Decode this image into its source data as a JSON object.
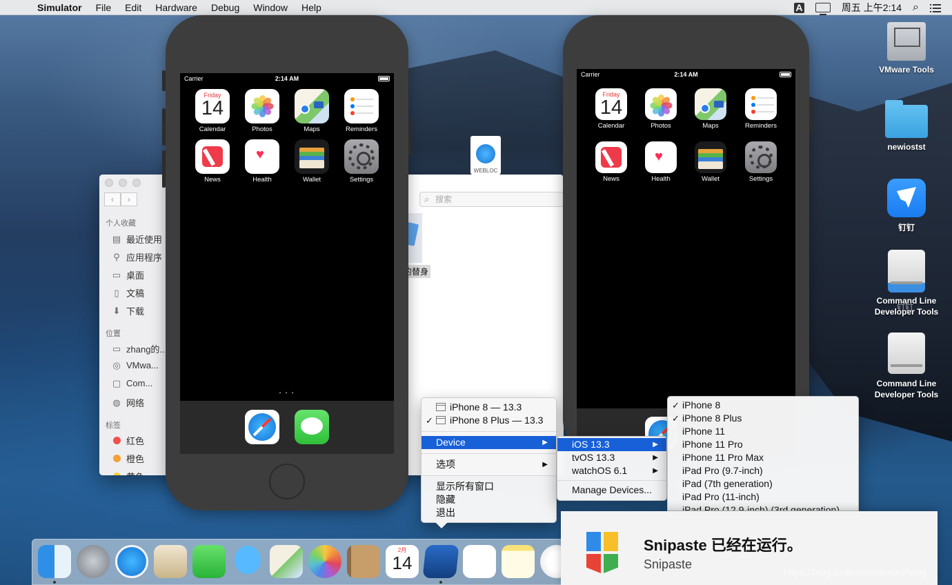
{
  "menubar": {
    "app_name": "Simulator",
    "items": [
      "File",
      "Edit",
      "Hardware",
      "Debug",
      "Window",
      "Help"
    ],
    "input_badge": "A",
    "clock": "周五 上午2:14"
  },
  "finder": {
    "search_placeholder": "搜索",
    "sections": {
      "favorites": "个人收藏",
      "locations": "位置",
      "tags": "标签"
    },
    "favorites": [
      "最近使用",
      "应用程序",
      "桌面",
      "文稿",
      "下载"
    ],
    "locations": [
      "zhang的...",
      "VMwa...",
      "Com...",
      "网络"
    ],
    "tags": [
      {
        "label": "红色",
        "color": "#f2504b"
      },
      {
        "label": "橙色",
        "color": "#f6a033"
      },
      {
        "label": "黄色",
        "color": "#f5cf3a"
      }
    ],
    "file_label": "的替身"
  },
  "webloc": {
    "label": "WEBLOC"
  },
  "device_left": {
    "carrier": "Carrier",
    "time": "2:14 AM",
    "page_dots": "• • •",
    "apps": [
      {
        "name": "Calendar",
        "icon": "calendar-icon"
      },
      {
        "name": "Photos",
        "icon": "photos-icon"
      },
      {
        "name": "Maps",
        "icon": "maps-icon"
      },
      {
        "name": "Reminders",
        "icon": "reminders-icon"
      },
      {
        "name": "News",
        "icon": "news-icon"
      },
      {
        "name": "Health",
        "icon": "health-icon"
      },
      {
        "name": "Wallet",
        "icon": "wallet-icon"
      },
      {
        "name": "Settings",
        "icon": "settings-icon"
      }
    ],
    "calendar_day": "Friday",
    "calendar_date": "14"
  },
  "device_right": {
    "carrier": "Carrier",
    "time": "2:14 AM",
    "apps": [
      "Calendar",
      "Photos",
      "Maps",
      "Reminders",
      "News",
      "Health",
      "Wallet",
      "Settings"
    ],
    "calendar_day": "Friday",
    "calendar_date": "14"
  },
  "desktop_icons": [
    {
      "label": "VMware Tools",
      "icon": "vmware-tools-icon"
    },
    {
      "label": "newiostst",
      "icon": "folder-icon"
    },
    {
      "label": "钉钉",
      "icon": "dingtalk-icon"
    },
    {
      "label": "Command Line Developer Tools",
      "icon": "drive-icon"
    },
    {
      "label": "Command Line Developer Tools",
      "icon": "drive-icon"
    }
  ],
  "overlap_label": "钉钉",
  "context_menu": {
    "windows": [
      {
        "label": "iPhone 8 — 13.3",
        "checked": false
      },
      {
        "label": "iPhone 8 Plus — 13.3",
        "checked": true
      }
    ],
    "device": "Device",
    "options": "选项",
    "show_all": "显示所有窗口",
    "hide": "隐藏",
    "quit": "退出"
  },
  "os_menu": {
    "items": [
      "iOS 13.3",
      "tvOS 13.3",
      "watchOS 6.1"
    ],
    "manage": "Manage Devices..."
  },
  "device_menu": {
    "items": [
      {
        "label": "iPhone 8",
        "checked": true
      },
      {
        "label": "iPhone 8 Plus",
        "checked": true
      },
      {
        "label": "iPhone 11",
        "checked": false
      },
      {
        "label": "iPhone 11 Pro",
        "checked": false
      },
      {
        "label": "iPhone 11 Pro Max",
        "checked": false
      },
      {
        "label": "iPad Pro (9.7-inch)",
        "checked": false
      },
      {
        "label": "iPad (7th generation)",
        "checked": false
      },
      {
        "label": "iPad Pro (11-inch)",
        "checked": false
      },
      {
        "label": "iPad Pro (12.9-inch) (3rd generation)",
        "checked": false
      }
    ]
  },
  "dock": {
    "apps": [
      "finder-icon",
      "launchpad-icon",
      "safari-icon",
      "mail-icon",
      "facetime-icon",
      "messages-icon",
      "maps-icon",
      "photos-icon",
      "contacts-icon",
      "calendar-icon",
      "xcode-icon",
      "reminders-icon",
      "notes-icon",
      "itunes-icon"
    ],
    "calendar_month": "2月",
    "calendar_date": "14"
  },
  "snipaste": {
    "title": "Snipaste 已经在运行。",
    "subtitle": "Snipaste"
  },
  "watermark": "https://blog.csdn.net/winniezhang",
  "colors": {
    "menu_selection": "#1760d8",
    "simulator_bezel": "#3d3d3e"
  }
}
